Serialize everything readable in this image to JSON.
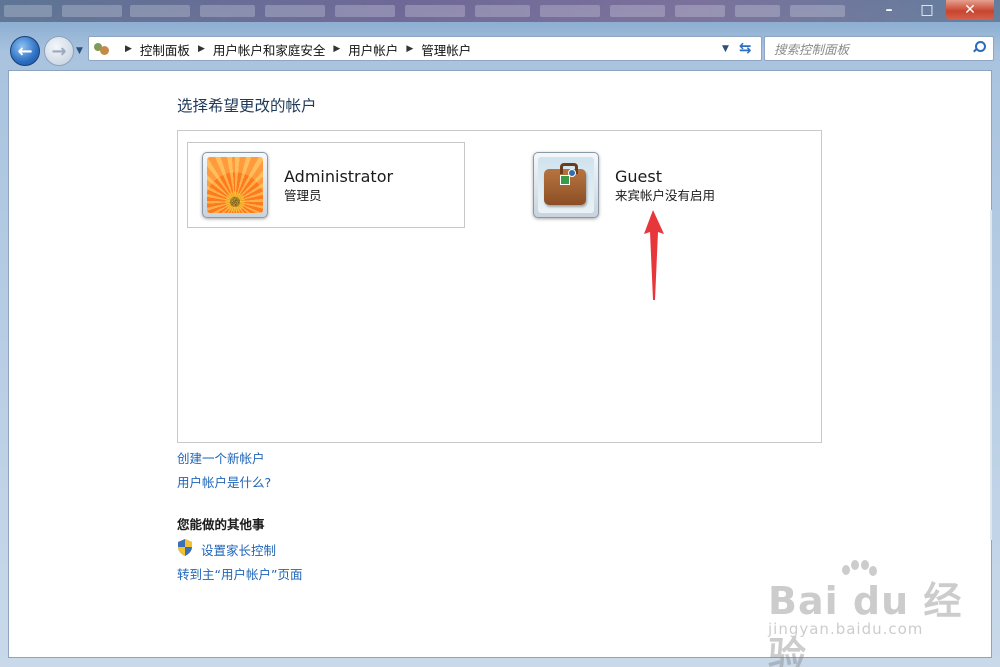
{
  "window": {
    "minimize_glyph": "–",
    "maximize_glyph": "□",
    "close_glyph": "✕"
  },
  "nav": {
    "back_glyph": "←",
    "forward_glyph": "→",
    "breadcrumbs": [
      "控制面板",
      "用户帐户和家庭安全",
      "用户帐户",
      "管理帐户"
    ],
    "search_placeholder": "搜索控制面板"
  },
  "main": {
    "title": "选择希望更改的帐户",
    "accounts": [
      {
        "name": "Administrator",
        "role": "管理员",
        "avatar": "orange-flower"
      },
      {
        "name": "Guest",
        "role": "来宾帐户没有启用",
        "avatar": "suitcase"
      }
    ],
    "links": {
      "create": "创建一个新帐户",
      "what": "用户帐户是什么?"
    },
    "other": {
      "title": "您能做的其他事",
      "parental": "设置家长控制",
      "main_page": "转到主“用户帐户”页面"
    }
  },
  "watermark": {
    "brand": "Bai du 经验",
    "sub": "jingyan.baidu.com"
  },
  "colors": {
    "link": "#1f65b8",
    "title": "#1e395b",
    "annotation_arrow": "#e8373a"
  }
}
